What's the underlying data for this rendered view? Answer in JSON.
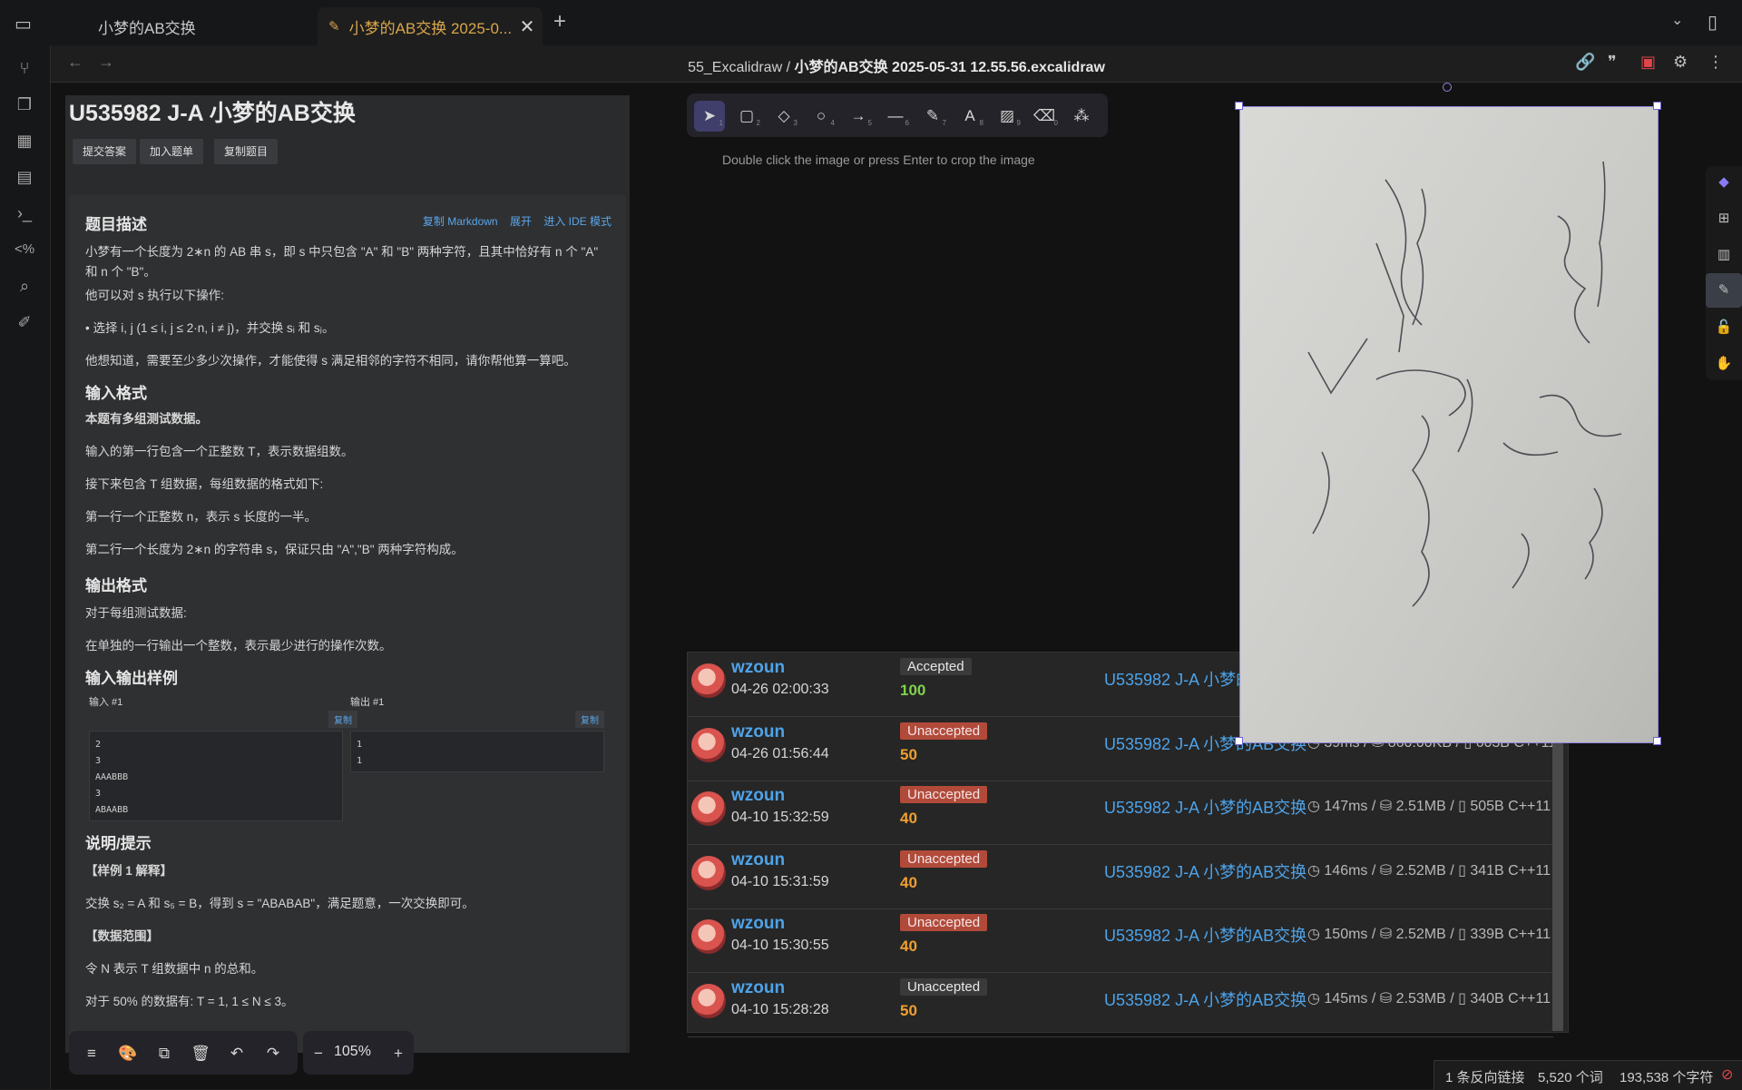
{
  "tabs": [
    {
      "label": "小梦的AB交换"
    },
    {
      "label": "小梦的AB交换 2025-0..."
    }
  ],
  "header": {
    "folder": "55_Excalidraw",
    "sep": "/",
    "file": "小梦的AB交换 2025-05-31 12.55.56.excalidraw"
  },
  "problem": {
    "title": "U535982 J-A 小梦的AB交换",
    "buttons": [
      "提交答案",
      "加入题单",
      "复制题目"
    ],
    "links": [
      "复制 Markdown",
      "展开",
      "进入 IDE 模式"
    ],
    "desc_h": "题目描述",
    "desc": [
      "小梦有一个长度为 2∗n 的 AB 串 s，即 s 中只包含 \"A\" 和 \"B\" 两种字符，且其中恰好有 n 个 \"A\" 和 n 个 \"B\"。",
      "他可以对 s 执行以下操作:",
      "• 选择 i, j (1 ≤ i, j ≤ 2·n, i ≠ j)，并交换 sᵢ 和 sⱼ。",
      "他想知道，需要至少多少次操作，才能使得 s 满足相邻的字符不相同，请你帮他算一算吧。"
    ],
    "input_h": "输入格式",
    "input": [
      "本题有多组测试数据。",
      "输入的第一行包含一个正整数 T，表示数据组数。",
      "接下来包含 T 组数据，每组数据的格式如下:",
      "第一行一个正整数 n，表示 s 长度的一半。",
      "第二行一个长度为 2∗n 的字符串 s，保证只由 \"A\",\"B\" 两种字符构成。"
    ],
    "output_h": "输出格式",
    "output": [
      "对于每组测试数据:",
      "在单独的一行输出一个整数，表示最少进行的操作次数。"
    ],
    "sample_h": "输入输出样例",
    "sample_in_label": "输入 #1",
    "sample_out_label": "输出 #1",
    "copy": "复制",
    "sample_in": [
      "2",
      "3",
      "AAABBB",
      "3",
      "ABAABB"
    ],
    "sample_out": [
      "1",
      "1"
    ],
    "note_h": "说明/提示",
    "note": [
      "【样例 1 解释】",
      "交换 s₂ = A 和 s₅ = B，得到 s = \"ABABAB\"，满足题意，一次交换即可。",
      "【数据范围】",
      "令 N 表示 T 组数据中 n 的总和。",
      "对于 50% 的数据有: T = 1, 1 ≤ N ≤ 3。"
    ]
  },
  "toolbar": {
    "hint": "Double click the image or press Enter to crop the image",
    "tools": [
      {
        "icon": "pointer-icon",
        "glyph": "➤",
        "key": "1"
      },
      {
        "icon": "rectangle-icon",
        "glyph": "▢",
        "key": "2"
      },
      {
        "icon": "diamond-icon",
        "glyph": "◇",
        "key": "3"
      },
      {
        "icon": "ellipse-icon",
        "glyph": "○",
        "key": "4"
      },
      {
        "icon": "arrow-icon",
        "glyph": "→",
        "key": "5"
      },
      {
        "icon": "line-icon",
        "glyph": "—",
        "key": "6"
      },
      {
        "icon": "pencil-icon",
        "glyph": "✎",
        "key": "7"
      },
      {
        "icon": "text-icon",
        "glyph": "A",
        "key": "8"
      },
      {
        "icon": "image-icon",
        "glyph": "▨",
        "key": "9"
      },
      {
        "icon": "eraser-icon",
        "glyph": "⌫",
        "key": "0"
      },
      {
        "icon": "shapes-icon",
        "glyph": "⁂",
        "key": ""
      }
    ]
  },
  "submissions": [
    {
      "user": "wzoun",
      "time": "04-26 02:00:33",
      "status": "Accepted",
      "kind": "acc",
      "score": "100",
      "score_color": "#7fd34a",
      "problem": "U535982 J-A 小梦的",
      "meta": ""
    },
    {
      "user": "wzoun",
      "time": "04-26 01:56:44",
      "status": "Unaccepted",
      "kind": "un",
      "score": "50",
      "score_color": "#f0a030",
      "problem": "U535982 J-A 小梦的AB交换",
      "meta": "◷ 39ms / ⛁ 860.00KB / ▯ 603B C++11"
    },
    {
      "user": "wzoun",
      "time": "04-10 15:32:59",
      "status": "Unaccepted",
      "kind": "un",
      "score": "40",
      "score_color": "#f0a030",
      "problem": "U535982 J-A 小梦的AB交换",
      "meta": "◷ 147ms / ⛁ 2.51MB / ▯ 505B C++11"
    },
    {
      "user": "wzoun",
      "time": "04-10 15:31:59",
      "status": "Unaccepted",
      "kind": "un",
      "score": "40",
      "score_color": "#f0a030",
      "problem": "U535982 J-A 小梦的AB交换",
      "meta": "◷ 146ms / ⛁ 2.52MB / ▯ 341B C++11"
    },
    {
      "user": "wzoun",
      "time": "04-10 15:30:55",
      "status": "Unaccepted",
      "kind": "un",
      "score": "40",
      "score_color": "#f0a030",
      "problem": "U535982 J-A 小梦的AB交换",
      "meta": "◷ 150ms / ⛁ 2.52MB / ▯ 339B C++11"
    },
    {
      "user": "wzoun",
      "time": "04-10 15:28:28",
      "status": "Unaccepted",
      "kind": "ungray",
      "score": "50",
      "score_color": "#f0a030",
      "problem": "U535982 J-A 小梦的AB交换",
      "meta": "◷ 145ms / ⛁ 2.53MB / ▯ 340B C++11"
    }
  ],
  "bottom": {
    "zoom": "105%"
  },
  "statusbar": {
    "backlinks": "1 条反向链接",
    "words": "5,520 个词",
    "chars": "193,538 个字符"
  },
  "colors": {
    "accent": "#d9a64a",
    "link": "#4ea3e8",
    "selection": "#6d63d6"
  }
}
